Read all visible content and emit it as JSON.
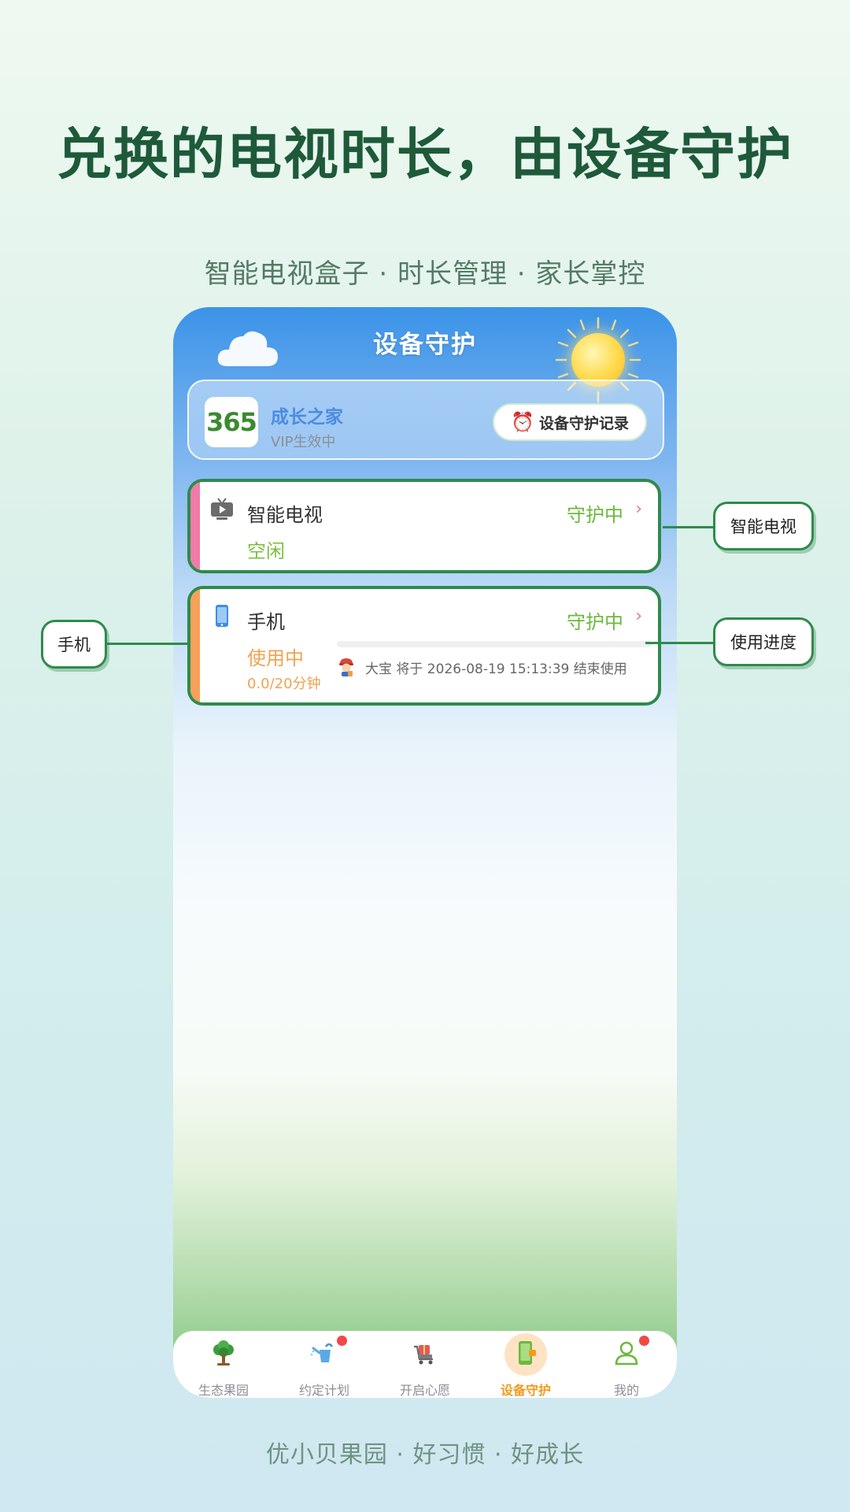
{
  "headline": "兑换的电视时长，由设备守护",
  "subline": "智能电视盒子 · 时长管理 · 家长掌控",
  "footer": "优小贝果园 · 好习惯 · 好成长",
  "phone": {
    "title": "设备守护",
    "member": {
      "logo_text": "365",
      "name": "成长之家",
      "status": "VIP生效中",
      "record_button": "设备守护记录"
    },
    "devices": [
      {
        "name": "智能电视",
        "icon": "tv-icon",
        "guard_status": "守护中",
        "status": "空闲",
        "status_color": "#7bbf3e",
        "bar_color": "#f07aa8"
      },
      {
        "name": "手机",
        "icon": "phone-icon",
        "guard_status": "守护中",
        "status": "使用中",
        "status_color": "#f0a352",
        "bar_color": "#f6a05a",
        "usage": "0.0/20分钟",
        "progress": 0.0,
        "usage_note": "大宝 将于 2026-08-19 15:13:39 结束使用"
      }
    ],
    "tabs": [
      {
        "label": "生态果园",
        "icon": "tree-icon",
        "active": false,
        "badge": false
      },
      {
        "label": "约定计划",
        "icon": "watering-can-icon",
        "active": false,
        "badge": true
      },
      {
        "label": "开启心愿",
        "icon": "gift-cart-icon",
        "active": false,
        "badge": false
      },
      {
        "label": "设备守护",
        "icon": "device-guard-icon",
        "active": true,
        "badge": false
      },
      {
        "label": "我的",
        "icon": "user-icon",
        "active": false,
        "badge": true
      }
    ]
  },
  "callouts": {
    "tv": "智能电视",
    "phone": "手机",
    "progress": "使用进度"
  },
  "colors": {
    "accent_green": "#2f8a4d",
    "guard_green": "#6cb83c",
    "active_tab": "#f39a1e"
  }
}
